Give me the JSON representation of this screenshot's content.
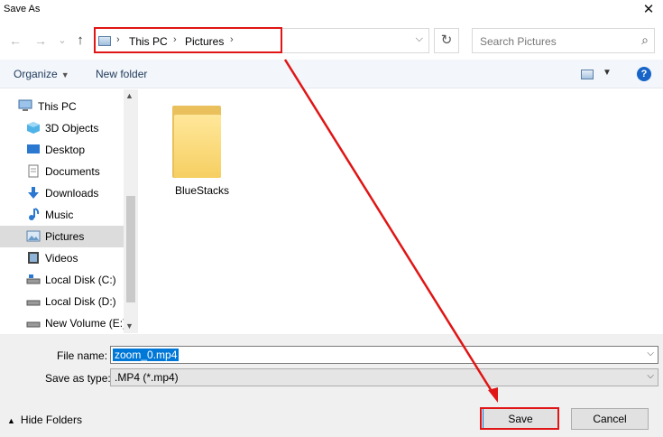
{
  "window": {
    "title": "Save As",
    "close_glyph": "✕"
  },
  "nav": {
    "back_glyph": "←",
    "forward_glyph": "→",
    "recent_glyph": "⌄",
    "up_glyph": "↑",
    "breadcrumb": [
      "This PC",
      "Pictures"
    ],
    "breadcrumb_sep": "›",
    "refresh_glyph": "↻",
    "search_placeholder": "Search Pictures",
    "search_icon": "search-icon"
  },
  "toolbar": {
    "organize": "Organize",
    "new_folder": "New folder",
    "help": "?"
  },
  "sidebar": {
    "items": [
      {
        "label": "This PC",
        "icon": "computer-icon"
      },
      {
        "label": "3D Objects",
        "icon": "cube-icon"
      },
      {
        "label": "Desktop",
        "icon": "desktop-icon"
      },
      {
        "label": "Documents",
        "icon": "document-icon"
      },
      {
        "label": "Downloads",
        "icon": "download-icon"
      },
      {
        "label": "Music",
        "icon": "music-icon"
      },
      {
        "label": "Pictures",
        "icon": "picture-icon",
        "selected": true
      },
      {
        "label": "Videos",
        "icon": "video-icon"
      },
      {
        "label": "Local Disk (C:)",
        "icon": "drive-icon"
      },
      {
        "label": "Local Disk (D:)",
        "icon": "drive-icon"
      },
      {
        "label": "New Volume (E:)",
        "icon": "drive-icon"
      }
    ]
  },
  "content": {
    "folders": [
      {
        "name": "BlueStacks",
        "icon": "folder-icon"
      }
    ]
  },
  "form": {
    "file_name_label": "File name:",
    "file_name_value": "zoom_0.mp4",
    "save_type_label": "Save as type:",
    "save_type_value": ".MP4 (*.mp4)"
  },
  "footer": {
    "hide_folders": "Hide Folders",
    "save": "Save",
    "cancel": "Cancel"
  },
  "annotation": {
    "color": "#e01515"
  }
}
